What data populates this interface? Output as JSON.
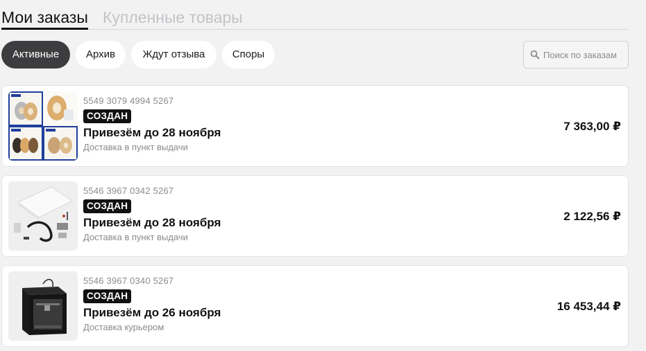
{
  "tabs": {
    "active": "Мои заказы",
    "inactive": "Купленные товары"
  },
  "filters": [
    {
      "label": "Активные",
      "active": true
    },
    {
      "label": "Архив",
      "active": false
    },
    {
      "label": "Ждут отзыва",
      "active": false
    },
    {
      "label": "Споры",
      "active": false
    }
  ],
  "search": {
    "placeholder": "Поиск по заказам",
    "icon": "search-icon"
  },
  "orders": [
    {
      "number": "5549 3079 4994 5267",
      "status": "СОЗДАН",
      "delivery": "Привезём до 28 ноября",
      "method": "Доставка в пункт выдачи",
      "price": "7 363,00 ₽",
      "image": "filament-spools-grid"
    },
    {
      "number": "5546 3967 0342 5267",
      "status": "СОЗДАН",
      "delivery": "Привезём до 28 ноября",
      "method": "Доставка в пункт выдачи",
      "price": "2 122,56 ₽",
      "image": "printer-bed-parts-kit"
    },
    {
      "number": "5546 3967 0340 5267",
      "status": "СОЗДАН",
      "delivery": "Привезём до 26 ноября",
      "method": "Доставка курьером",
      "price": "16 453,44 ₽",
      "image": "3d-printer"
    }
  ],
  "colors": {
    "background": "#f2f2f3",
    "active_chip": "#3d3d3f",
    "badge": "#111111",
    "muted_text": "#8b8b90"
  }
}
